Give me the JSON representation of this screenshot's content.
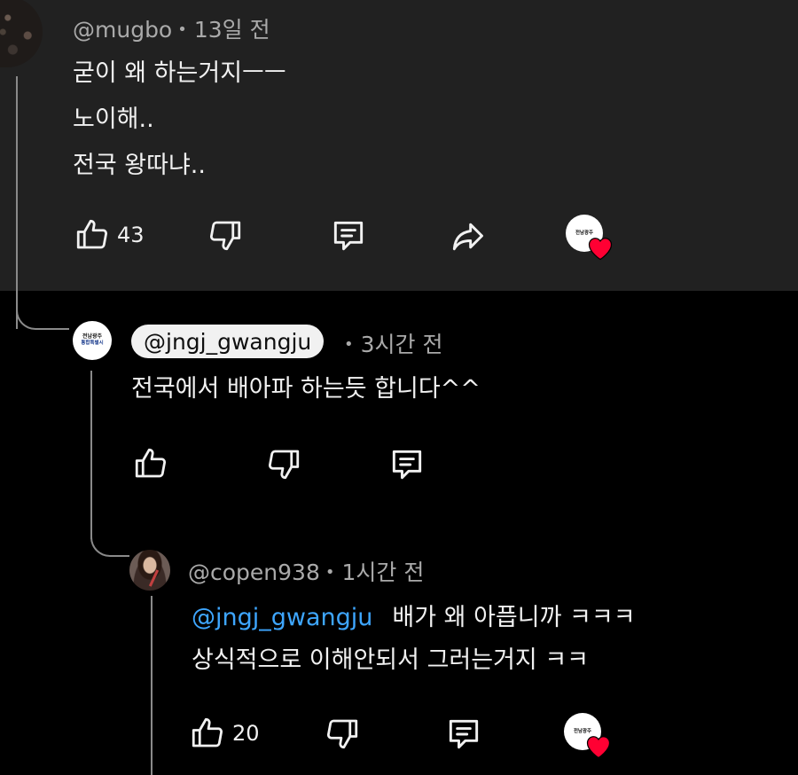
{
  "comment1": {
    "username": "@mugbo",
    "time": "13일 전",
    "lines": [
      "굳이 왜 하는거지ㅡㅡ",
      "노이해..",
      "전국 왕따냐.."
    ],
    "like_count": "43"
  },
  "comment2": {
    "username": "@jngj_gwangju",
    "time": "3시간 전",
    "lines": [
      "전국에서 배아파 하는듯 합니다^^"
    ],
    "avatar_text_1": "전남광주",
    "avatar_text_2": "통합특별시"
  },
  "comment3": {
    "username": "@copen938",
    "time": "1시간 전",
    "mention": "@jngj_gwangju",
    "line1": "배가 왜 아픕니까 ㅋㅋㅋ",
    "line2": "상식적으로 이해안되서 그러는거지 ㅋㅋ",
    "like_count": "20"
  },
  "separator": "•",
  "colors": {
    "top_background": "#212121",
    "background": "#000000",
    "text": "#f1f1f1",
    "meta_text": "#aaaaaa",
    "link": "#3ea6ff",
    "heart": "#ff0033"
  },
  "icons": [
    "like-icon",
    "dislike-icon",
    "reply-icon",
    "share-icon",
    "creator-heart-icon"
  ]
}
